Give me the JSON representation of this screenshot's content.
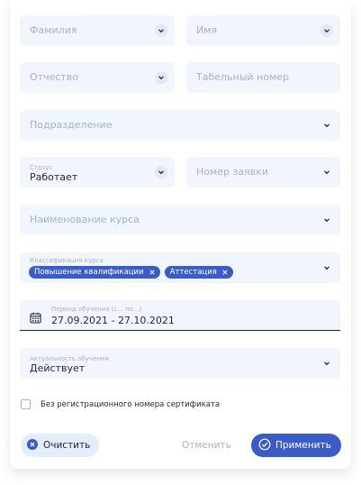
{
  "filters": {
    "last_name": {
      "placeholder": "Фамилия"
    },
    "first_name": {
      "placeholder": "Имя"
    },
    "middle_name": {
      "placeholder": "Отчество"
    },
    "personnel_number": {
      "placeholder": "Табельный номер"
    },
    "department": {
      "placeholder": "Подразделение"
    },
    "status": {
      "label": "Статус",
      "value": "Работает"
    },
    "request_number": {
      "placeholder": "Номер заявки"
    },
    "course_name": {
      "placeholder": "Наименование курса"
    },
    "course_classification": {
      "label": "Классификация курса",
      "chips": [
        "Повышение квалификации",
        "Аттестация"
      ]
    },
    "training_period": {
      "label": "Период обучения (с... по...)",
      "value": "27.09.2021 - 27.10.2021"
    },
    "training_relevance": {
      "label": "Актуальность обучения",
      "value": "Действует"
    }
  },
  "checkbox": {
    "label": "Без регистрационного номера сертификата",
    "checked": false
  },
  "actions": {
    "clear_label": "Очистить",
    "cancel_label": "Отменить",
    "apply_label": "Применить"
  },
  "colors": {
    "accent": "#3b5cc8",
    "field_bg": "#f1f5fd",
    "placeholder": "#a9b1c3",
    "clear_bg": "#e4edfb"
  }
}
